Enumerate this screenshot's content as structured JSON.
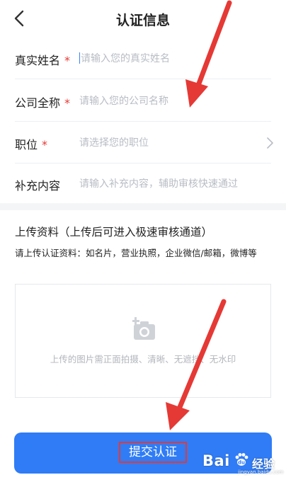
{
  "header": {
    "title": "认证信息",
    "back_icon": "chevron-left-icon"
  },
  "form": {
    "required_mark": "*",
    "rows": [
      {
        "label": "真实姓名",
        "required": true,
        "placeholder": "请输入您的真实姓名",
        "focused": true
      },
      {
        "label": "公司全称",
        "required": true,
        "placeholder": "请输入您的公司名称"
      },
      {
        "label": "职位",
        "required": true,
        "placeholder": "请选择您的职位",
        "icon": "chevron-right-icon"
      },
      {
        "label": "补充内容",
        "required": false,
        "placeholder": "请输入补充内容，辅助审核快速通过"
      }
    ]
  },
  "upload": {
    "title": "上传资料（上传后可进入极速审核通道）",
    "description": "请上传认证资料：如名片，营业执照，企业微信/邮箱，微博等",
    "hint": "上传的图片需正面拍摄、清晰、无遮挡、无水印",
    "icon": "camera-add-icon"
  },
  "submit": {
    "label": "提交认证"
  },
  "watermark": {
    "text_a": "Bai",
    "text_b": "经验",
    "url": "jingyan.baidu.com"
  },
  "colors": {
    "primary": "#2f7cf6",
    "required": "#e53935",
    "annotation": "#e53935",
    "placeholder": "#b8bcc4"
  }
}
